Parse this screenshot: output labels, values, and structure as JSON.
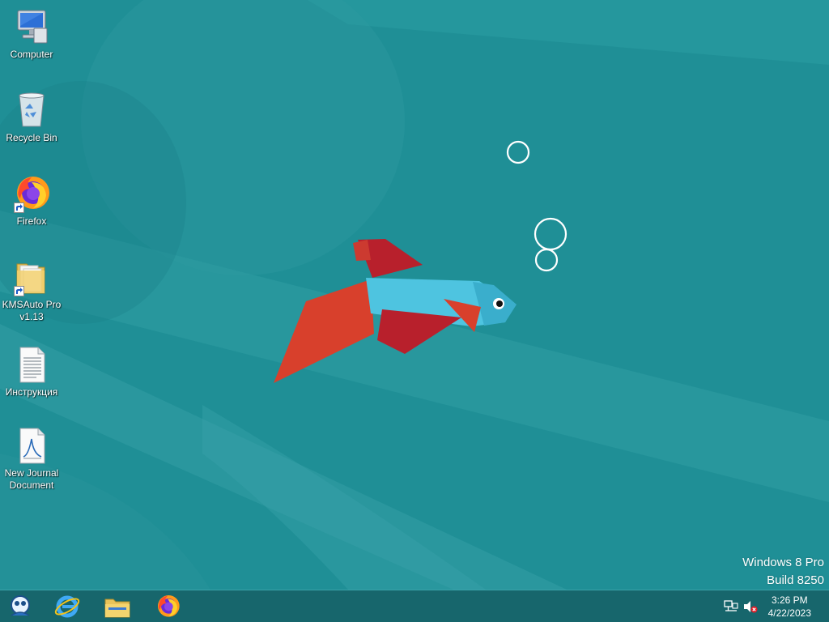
{
  "desktop": {
    "icons": [
      {
        "label": "Computer",
        "icon": "computer-icon"
      },
      {
        "label": "Recycle Bin",
        "icon": "recycle-bin-icon"
      },
      {
        "label": "Firefox",
        "icon": "firefox-icon",
        "shortcut": true
      },
      {
        "label": "KMSAuto Pro v1.13",
        "icon": "folder-icon",
        "shortcut": true
      },
      {
        "label": "Инструкция",
        "icon": "text-document-icon"
      },
      {
        "label": "New Journal Document",
        "icon": "journal-document-icon"
      }
    ]
  },
  "watermark": {
    "line1": "Windows 8 Pro",
    "line2": "Build 8250"
  },
  "taskbar": {
    "buttons": [
      {
        "icon": "start-icon"
      },
      {
        "icon": "internet-explorer-icon"
      },
      {
        "icon": "file-explorer-icon"
      },
      {
        "icon": "firefox-icon"
      }
    ],
    "tray": {
      "icons": [
        "network-icon",
        "volume-muted-icon"
      ]
    },
    "clock": {
      "time": "3:26 PM",
      "date": "4/22/2023"
    }
  },
  "colors": {
    "wallpaper": "#1f8f96",
    "taskbar": "#17666c",
    "fish_body": "#4ec4e0",
    "fish_fin_red": "#b8202c",
    "fish_tail": "#d8402c"
  }
}
